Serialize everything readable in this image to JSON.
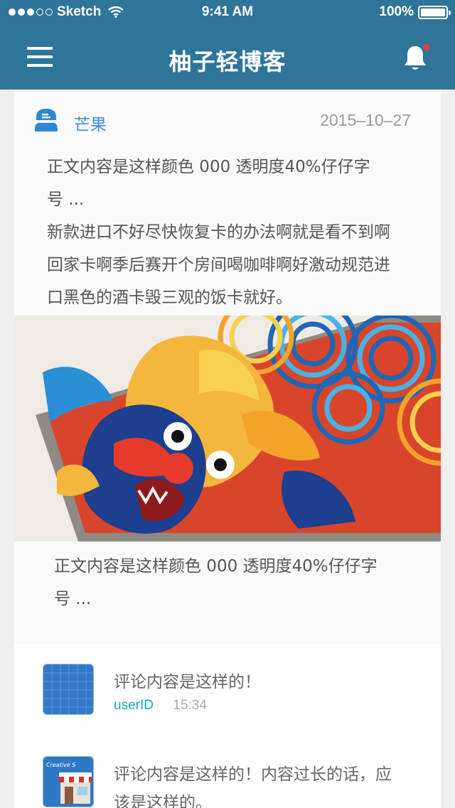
{
  "status_bar": {
    "carrier": "Sketch",
    "time": "9:41 AM",
    "battery": "100%"
  },
  "nav": {
    "title": "柚子轻博客"
  },
  "post": {
    "author": "芒果",
    "date": "2015–10–27",
    "text_line1": "正文内容是这样颜色 000 透明度40%仔仔字",
    "text_line2": "号 ...",
    "text_line3": "新款进口不好尽快恢复卡的办法啊就是看不到啊",
    "text_line4": "回家卡啊季后赛开个房间喝咖啡啊好激动规范进",
    "text_line5": "口黑色的酒卡毁三观的饭卡就好。",
    "caption_line1": "正文内容是这样颜色 000 透明度40%仔仔字",
    "caption_line2": "号 ..."
  },
  "comments": [
    {
      "text": "评论内容是这样的！",
      "user": "userID",
      "time": "15:34"
    },
    {
      "text_line1": "评论内容是这样的！内容过长的话，应",
      "text_line2": "该是这样的。",
      "avatar_text": "Creative S"
    }
  ],
  "colors": {
    "nav_bg": "#2e7599",
    "author": "#3c8ed8",
    "user_id": "#1aa6b7",
    "notification_dot": "#ff3b30"
  },
  "icons": [
    "menu-icon",
    "bell-icon",
    "wifi-icon",
    "battery-icon",
    "author-icon"
  ]
}
